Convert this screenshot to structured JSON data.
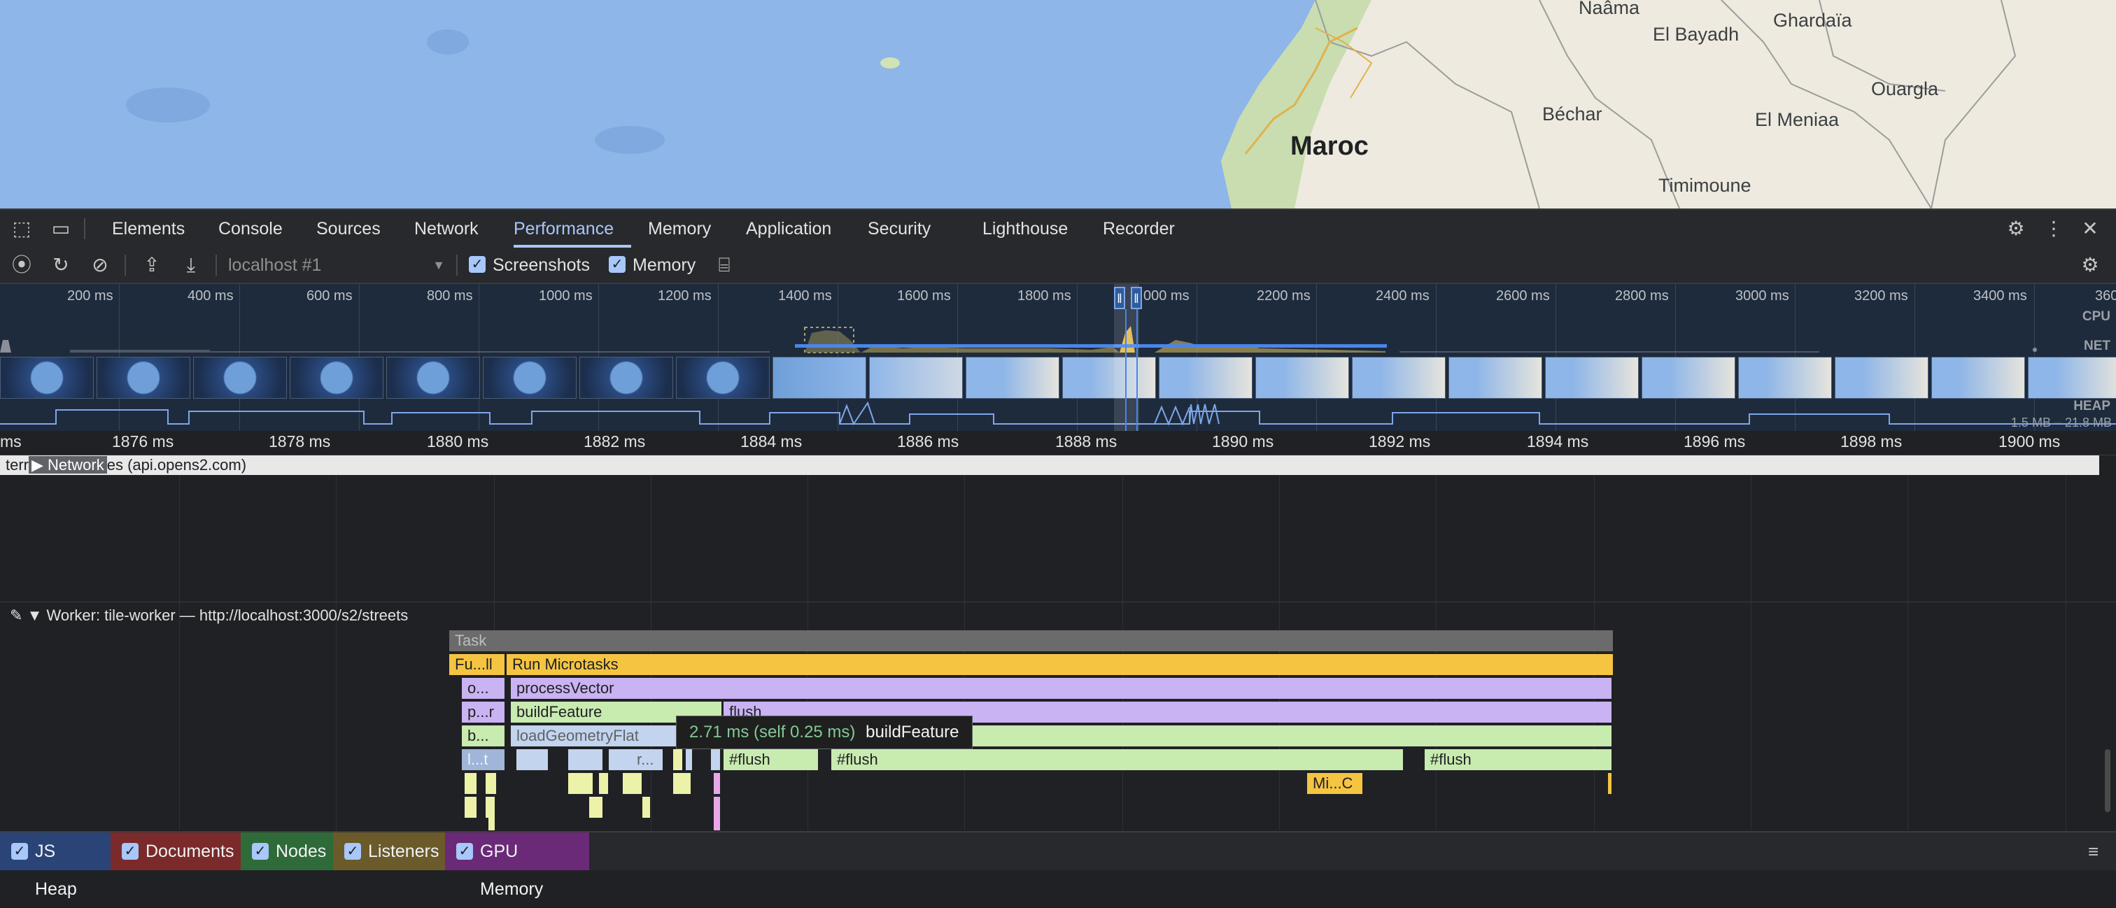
{
  "map": {
    "labels": [
      "Naâma",
      "El Bayadh",
      "Ghardaïa",
      "Ouargla",
      "Béchar",
      "El Meniaa",
      "Maroc",
      "Timimoune"
    ]
  },
  "devtools": {
    "tabs": [
      "Elements",
      "Console",
      "Sources",
      "Network",
      "Performance",
      "Memory",
      "Application",
      "Security",
      "Lighthouse",
      "Recorder"
    ],
    "active_tab": "Performance"
  },
  "toolbar": {
    "target": "localhost #1",
    "screenshots_label": "Screenshots",
    "memory_label": "Memory"
  },
  "overview": {
    "ticks": [
      "200 ms",
      "400 ms",
      "600 ms",
      "800 ms",
      "1000 ms",
      "1200 ms",
      "1400 ms",
      "1600 ms",
      "1800 ms",
      "000 ms",
      "2200 ms",
      "2400 ms",
      "2600 ms",
      "2800 ms",
      "3000 ms",
      "3200 ms",
      "3400 ms",
      "360"
    ],
    "cpu_label": "CPU",
    "net_label": "NET",
    "heap_label": "HEAP",
    "heap_range": "1.5 MB – 21.8 MB"
  },
  "ruler": {
    "ticks": [
      "ms",
      "1876 ms",
      "1878 ms",
      "1880 ms",
      "1882 ms",
      "1884 ms",
      "1886 ms",
      "1888 ms",
      "1890 ms",
      "1892 ms",
      "1894 ms",
      "1896 ms",
      "1898 ms",
      "1900 ms"
    ]
  },
  "network": {
    "request_text_a": "terr",
    "track_label": "Network",
    "request_text_b": "es (api.opens2.com)"
  },
  "worker": {
    "title": "Worker: tile-worker — http://localhost:3000/s2/streets"
  },
  "flame": {
    "task": "Task",
    "fu_ll": "Fu...ll",
    "run_microtasks": "Run Microtasks",
    "o_short": "o...",
    "process_vector": "processVector",
    "p_r": "p...r",
    "build_feature": "buildFeature",
    "flush_a": "flush",
    "b_short": "b...",
    "load_geometry_flat": "loadGeometryFlat",
    "l_t": "l...t",
    "r_short": "r...",
    "flush_b": "#flush",
    "flush_c": "#flush",
    "flush_d": "#flush",
    "mi_c": "Mi...C"
  },
  "tooltip": {
    "time": "2.71 ms (self 0.25 ms)",
    "name": "buildFeature"
  },
  "counters": [
    "JS Heap",
    "Documents",
    "Nodes",
    "Listeners",
    "GPU Memory"
  ]
}
